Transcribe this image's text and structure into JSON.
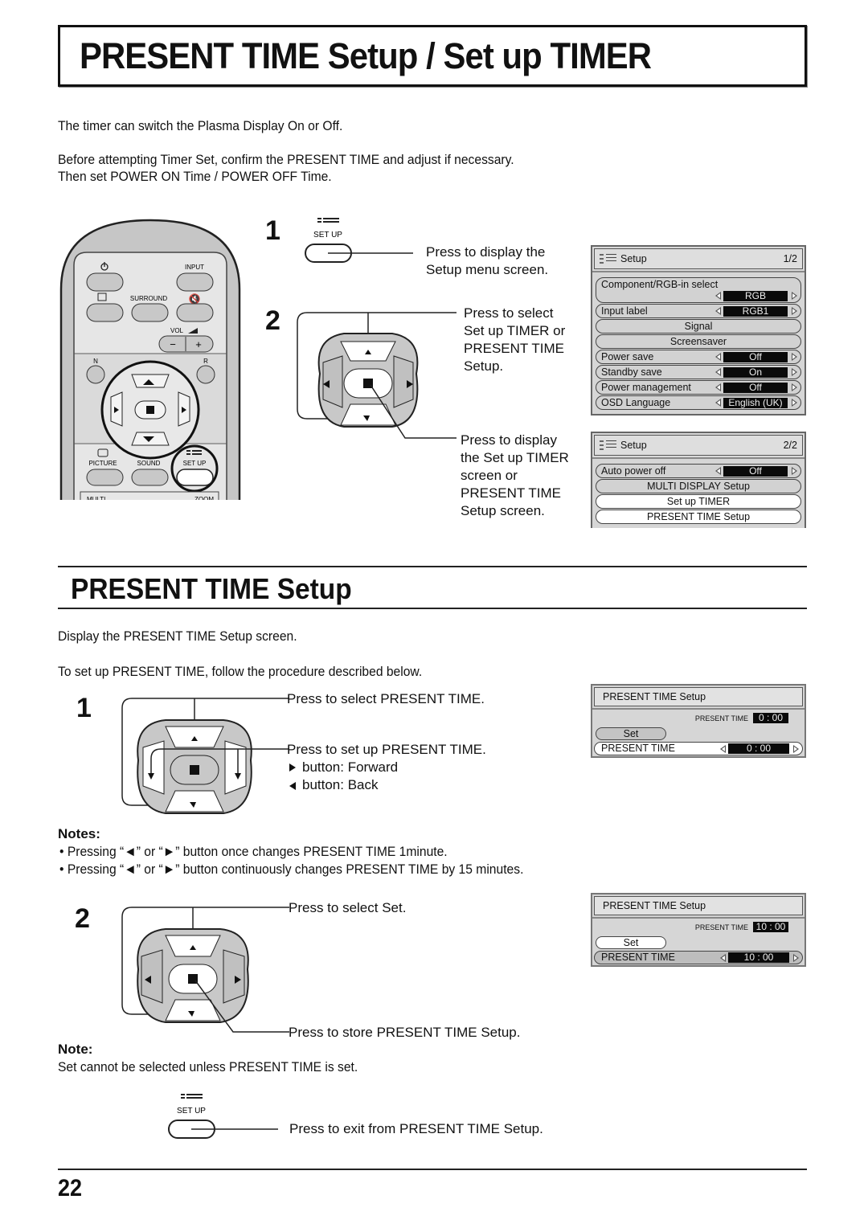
{
  "page": {
    "title": "PRESENT TIME Setup / Set up TIMER",
    "intro": [
      "The timer can switch the Plasma Display On or Off.",
      "Before attempting Timer Set, confirm the PRESENT TIME and adjust if necessary.",
      "Then set POWER ON Time / POWER OFF Time."
    ],
    "page_number": "22"
  },
  "remote": {
    "buttons": {
      "power": "power-icon",
      "input": "INPUT",
      "surround": "SURROUND",
      "vol": "VOL",
      "vol_minus": "−",
      "vol_plus": "+",
      "n": "N",
      "r": "R",
      "picture": "PICTURE",
      "sound": "SOUND",
      "setup": "SET UP",
      "multi": "MULTI",
      "zoom": "ZOOM"
    }
  },
  "overview_steps": {
    "step1": {
      "number": "1",
      "button_label": "SET UP",
      "text": [
        "Press to display the",
        "Setup menu screen."
      ]
    },
    "step2": {
      "number": "2",
      "select_text": [
        "Press to select",
        "Set up TIMER or",
        "PRESENT TIME",
        "Setup."
      ],
      "display_text": [
        "Press to display",
        "the Set up TIMER",
        "screen or",
        "PRESENT TIME",
        "Setup screen."
      ]
    }
  },
  "setup_menu_1": {
    "title": "Setup",
    "page": "1/2",
    "items": [
      {
        "label": "Component/RGB-in  select",
        "value": "RGB",
        "type": "tall"
      },
      {
        "label": "Input label",
        "value": "RGB1",
        "type": "value"
      },
      {
        "label": "Signal",
        "type": "center"
      },
      {
        "label": "Screensaver",
        "type": "center"
      },
      {
        "label": "Power save",
        "value": "Off",
        "type": "value"
      },
      {
        "label": "Standby save",
        "value": "On",
        "type": "value"
      },
      {
        "label": "Power management",
        "value": "Off",
        "type": "value"
      },
      {
        "label": "OSD  Language",
        "value": "English (UK)",
        "type": "value"
      }
    ]
  },
  "setup_menu_2": {
    "title": "Setup",
    "page": "2/2",
    "items": [
      {
        "label": "Auto power off",
        "value": "Off",
        "type": "value"
      },
      {
        "label": "MULTI DISPLAY Setup",
        "type": "center"
      },
      {
        "label": "Set up TIMER",
        "type": "center-white"
      },
      {
        "label": "PRESENT  TIME  Setup",
        "type": "center-white"
      }
    ]
  },
  "present_time_section": {
    "title": "PRESENT TIME Setup",
    "intro": [
      "Display the PRESENT TIME Setup screen.",
      "To set up PRESENT TIME, follow the procedure described below."
    ],
    "step1": {
      "number": "1",
      "select_text": "Press to select PRESENT TIME.",
      "setup_text": "Press to set up PRESENT TIME.",
      "forward_text": "button: Forward",
      "back_text": "button: Back"
    },
    "notes_heading": "Notes:",
    "notes": [
      "• Pressing “◄” or “►” button once changes PRESENT TIME 1minute.",
      "• Pressing “◄” or “►” button continuously changes PRESENT TIME by 15 minutes."
    ],
    "step2": {
      "number": "2",
      "select_text": "Press to select Set.",
      "store_text": "Press to store PRESENT TIME Setup."
    },
    "note_heading": "Note:",
    "note": "Set cannot be selected unless PRESENT TIME is set.",
    "exit": {
      "button_label": "SET UP",
      "text": "Press to exit from PRESENT TIME Setup."
    }
  },
  "pt_menu_1": {
    "title": "PRESENT TIME Setup",
    "mini_label": "PRESENT TIME",
    "mini_value": "0 : 00",
    "set_label": "Set",
    "row_label": "PRESENT TIME",
    "row_value": "0 : 00",
    "highlight": "row"
  },
  "pt_menu_2": {
    "title": "PRESENT TIME Setup",
    "mini_label": "PRESENT TIME",
    "mini_value": "10 : 00",
    "set_label": "Set",
    "row_label": "PRESENT TIME",
    "row_value": "10 : 00",
    "highlight": "set"
  },
  "colors": {
    "text": "#111111",
    "osd_bg": "#d6d6d6",
    "osd_value_bg": "#0a0a0a",
    "remote_body": "#d0d0d0",
    "dpad_gray": "#c8c8c8"
  }
}
